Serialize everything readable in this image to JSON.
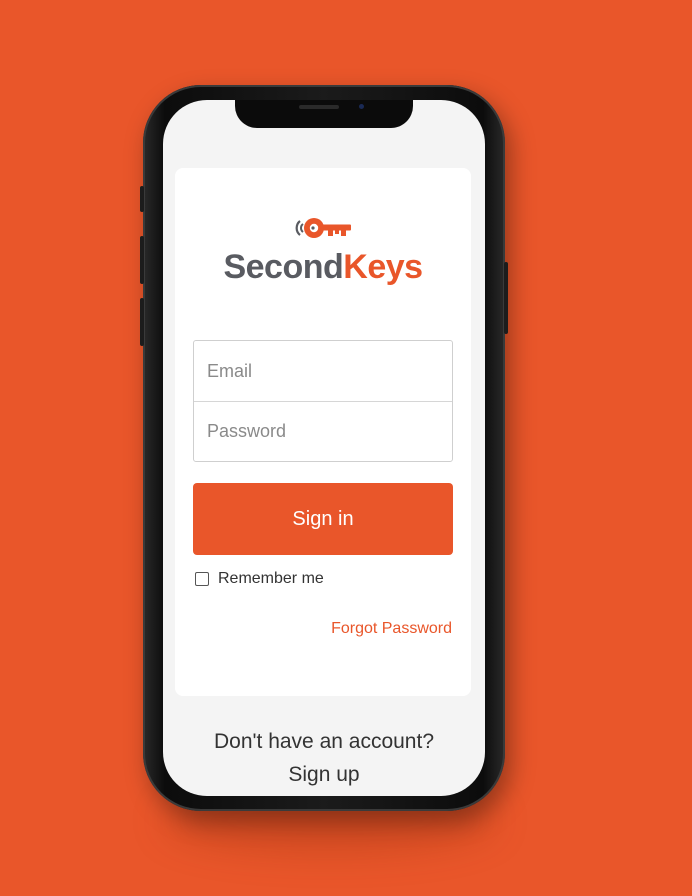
{
  "brand": {
    "name_part1": "Second",
    "name_part2": "Keys",
    "logo_icon": "key-icon",
    "accent_color": "#e9562a",
    "text_color": "#595b61"
  },
  "login_form": {
    "email_placeholder": "Email",
    "password_placeholder": "Password",
    "signin_label": "Sign in",
    "remember_label": "Remember me",
    "remember_checked": false,
    "forgot_label": "Forgot Password"
  },
  "footer": {
    "prompt": "Don't have an account?",
    "signup_label": "Sign up"
  }
}
